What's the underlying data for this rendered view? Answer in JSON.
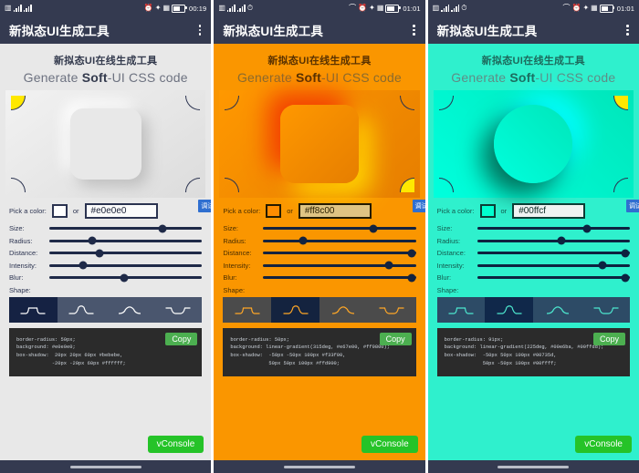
{
  "app": {
    "title": "新拟态UI生成工具",
    "heading_cn": "新拟态UI在线生成工具",
    "heading_en_pre": "Generate ",
    "heading_en_strong": "Soft",
    "heading_en_post": "-UI CSS code",
    "menu_icon": "kebab-menu-icon"
  },
  "labels": {
    "pick_a_color": "Pick a color:",
    "or": "or",
    "size": "Size:",
    "radius": "Radius:",
    "distance": "Distance:",
    "intensity": "Intensity:",
    "blur": "Blur:",
    "shape": "Shape:",
    "copy": "Copy",
    "vconsole": "vConsole",
    "debug": "调试"
  },
  "panels": [
    {
      "id": "panel-light",
      "theme": "light",
      "statusbar": {
        "time": "00:19",
        "left_icons": [
          "sim-icon",
          "signal-icon",
          "signal-icon"
        ],
        "right_icons": [
          "alarm-icon",
          "bluetooth-icon",
          "vibrate-icon",
          "battery-icon"
        ]
      },
      "color_hex": "#e0e0e0",
      "accent": "#e0e0e0",
      "selected_corner": "top-left",
      "selected_shape_index": 0,
      "sliders": {
        "size": 74,
        "radius": 28,
        "distance": 33,
        "intensity": 22,
        "blur": 49
      },
      "code": "border-radius: 50px;\nbackground: #e0e0e0;\nbox-shadow:  20px 20px 60px #bebebe,\n            -20px -20px 60px #ffffff;"
    },
    {
      "id": "panel-orange",
      "theme": "orange",
      "statusbar": {
        "time": "01:01",
        "left_icons": [
          "sim-icon",
          "signal-icon",
          "signal-icon",
          "alarm-icon"
        ],
        "right_icons": [
          "headphone-icon",
          "alarm-icon",
          "bluetooth-icon",
          "vibrate-icon",
          "battery-icon"
        ]
      },
      "color_hex": "#ff8c00",
      "accent": "#ff8c00",
      "selected_corner": "bottom-right",
      "selected_shape_index": 1,
      "sliders": {
        "size": 72,
        "radius": 26,
        "distance": 97,
        "intensity": 82,
        "blur": 97
      },
      "code": "border-radius: 50px;\nbackground: linear-gradient(315deg, #e67e00, #ff9800);\nbox-shadow:  -50px -50px 100px #f33f00,\n             50px 50px 100px #ffd900;"
    },
    {
      "id": "panel-teal",
      "theme": "teal",
      "statusbar": {
        "time": "01:01",
        "left_icons": [
          "sim-icon",
          "signal-icon",
          "signal-icon",
          "alarm-icon"
        ],
        "right_icons": [
          "headphone-icon",
          "alarm-icon",
          "bluetooth-icon",
          "vibrate-icon",
          "battery-icon"
        ]
      },
      "color_hex": "#00ffcf",
      "accent": "#00ffcf",
      "selected_corner": "top-right",
      "selected_shape_index": 1,
      "sliders": {
        "size": 72,
        "radius": 55,
        "distance": 97,
        "intensity": 82,
        "blur": 97
      },
      "code": "border-radius: 91px;\nbackground: linear-gradient(225deg, #00e6ba, #00ffdd);\nbox-shadow:  -50px 50px 100px #00735d,\n             50px -50px 100px #00ffff;"
    }
  ],
  "colors": {
    "chrome": "#343a50",
    "copy_green": "#4caf50",
    "vconsole_green": "#25c328",
    "debug_blue": "#2f6fd0",
    "corner_highlight": "#ffe800"
  }
}
